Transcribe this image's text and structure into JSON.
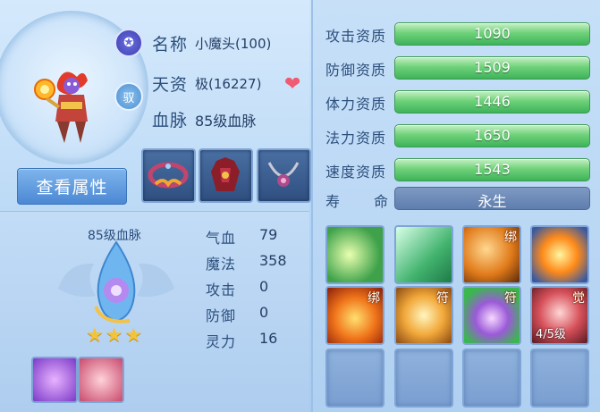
{
  "pet": {
    "name_label": "名称",
    "name_value": "小魔头(100)",
    "talent_label": "天资",
    "talent_value": "极(16227)",
    "bloodline_label": "血脉",
    "bloodline_value": "85级血脉",
    "badge_top_icon": "pet-emblem-icon",
    "badge_mid_text": "驭",
    "view_attrs_button": "查看属性"
  },
  "bloodline_panel": {
    "title": "85级血脉",
    "stars": "★★★",
    "stats": [
      {
        "label": "气血",
        "value": "79"
      },
      {
        "label": "魔法",
        "value": "358"
      },
      {
        "label": "攻击",
        "value": "0"
      },
      {
        "label": "防御",
        "value": "0"
      },
      {
        "label": "灵力",
        "value": "16"
      }
    ]
  },
  "aptitudes": [
    {
      "label": "攻击资质",
      "value": "1090"
    },
    {
      "label": "防御资质",
      "value": "1509"
    },
    {
      "label": "体力资质",
      "value": "1446"
    },
    {
      "label": "法力资质",
      "value": "1650"
    },
    {
      "label": "速度资质",
      "value": "1543"
    }
  ],
  "lifespan": {
    "label_a": "寿",
    "label_b": "命",
    "value": "永生"
  },
  "skills": {
    "tags": {
      "bind": "绑",
      "talisman": "符",
      "awaken": "觉"
    },
    "awaken_level": "4/5级"
  },
  "colors": {
    "bar_green": "#4fc265",
    "heart": "#f05a72",
    "star": "#f3c33a"
  }
}
